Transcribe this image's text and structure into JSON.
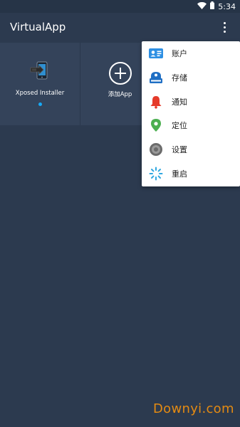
{
  "status_bar": {
    "time": "5:34"
  },
  "app_bar": {
    "title": "VirtualApp"
  },
  "apps": [
    {
      "label": "Xposed Installer"
    },
    {
      "label": "添加App"
    }
  ],
  "menu": {
    "items": [
      {
        "label": "账户",
        "icon": "account-icon"
      },
      {
        "label": "存储",
        "icon": "storage-icon"
      },
      {
        "label": "通知",
        "icon": "bell-icon"
      },
      {
        "label": "定位",
        "icon": "location-pin-icon"
      },
      {
        "label": "设置",
        "icon": "settings-icon"
      },
      {
        "label": "重启",
        "icon": "restart-spinner-icon"
      }
    ]
  },
  "watermark": {
    "text": "Downyi.com"
  },
  "colors": {
    "background": "#2c3a4f",
    "tile": "#34435a",
    "indicator_dot": "#17a9f5",
    "watermark": "#e38a12"
  }
}
